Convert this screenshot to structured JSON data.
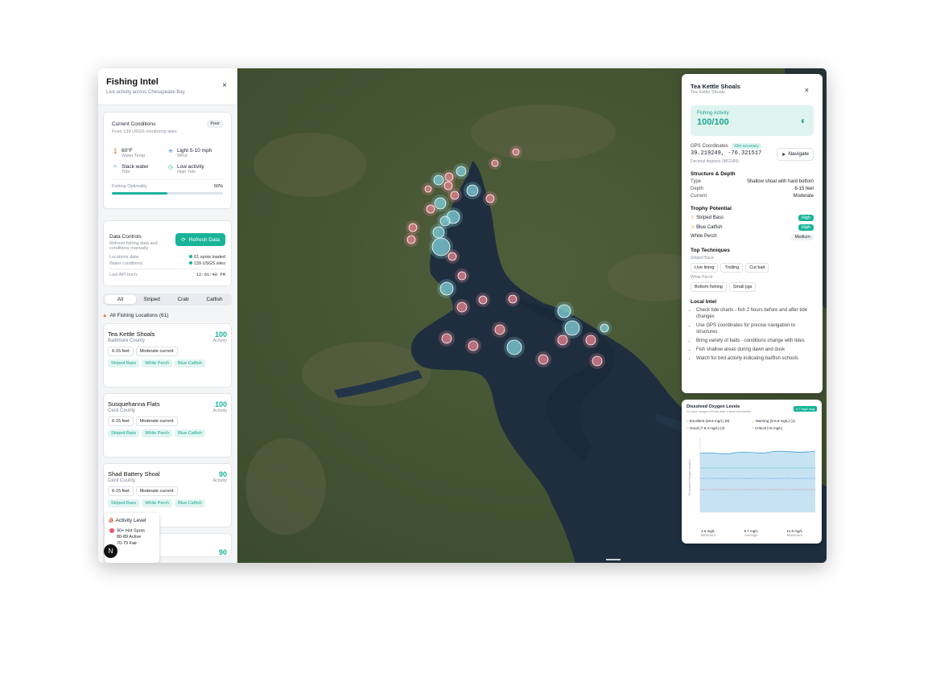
{
  "sidebar": {
    "title": "Fishing Intel",
    "subtitle": "Live activity across Chesapeake Bay",
    "close": "×",
    "conditions": {
      "title": "Current Conditions",
      "badge": "Poor",
      "source": "From 139 USGS monitoring sites",
      "items": [
        {
          "icon": "thermometer-icon",
          "value": "60°F",
          "label": "Water Temp"
        },
        {
          "icon": "wind-icon",
          "value": "Light 5-10 mph",
          "label": "Wind"
        },
        {
          "icon": "water-icon",
          "value": "Slack water",
          "label": "Tide"
        },
        {
          "icon": "clock-icon",
          "value": "Low activity",
          "label": "High Tide"
        }
      ],
      "optimality_label": "Fishing Optimality",
      "optimality_value": "50%",
      "optimality": 0.5
    },
    "data_controls": {
      "title": "Data Controls",
      "desc": "Refresh fishing data and conditions manually",
      "button": "Refresh Data",
      "rows": [
        {
          "label": "Locations data:",
          "value": "61 spots loaded"
        },
        {
          "label": "Water conditions:",
          "value": "139 USGS sites"
        },
        {
          "label": "Last API fetch:",
          "value": "12:01:48 PM"
        }
      ]
    },
    "tabs": [
      "All",
      "Striped",
      "Crab",
      "Catfish"
    ],
    "list_title": "All Fishing Locations (61)",
    "locations": [
      {
        "name": "Tea Kettle Shoals",
        "county": "Baltimore County",
        "score": "100",
        "activity": "Activity",
        "tags": [
          "6-15 feet",
          "Moderate current"
        ],
        "fish": [
          "Striped Bass",
          "White Perch",
          "Blue Catfish"
        ]
      },
      {
        "name": "Susquehanna Flats",
        "county": "Cecil County",
        "score": "100",
        "activity": "Activity",
        "tags": [
          "6-15 feet",
          "Moderate current"
        ],
        "fish": [
          "Striped Bass",
          "White Perch",
          "Blue Catfish"
        ]
      },
      {
        "name": "Shad Battery Shoal",
        "county": "Cecil County",
        "score": "90",
        "activity": "Activity",
        "tags": [
          "6-15 feet",
          "Moderate current"
        ],
        "fish": [
          "Striped Bass",
          "White Perch",
          "Blue Catfish"
        ]
      }
    ],
    "partial_score": "90",
    "legend": {
      "title": "Activity Level",
      "items": [
        {
          "label": "90+ Hot Spots",
          "color": "#e85a6a"
        },
        {
          "label": "80-89 Active",
          "color": "#f08a5d"
        },
        {
          "label": "70-79 Fair",
          "color": "#f2c14e"
        }
      ]
    },
    "next_badge": "N"
  },
  "panel": {
    "title": "Tea Kettle Shoals",
    "subtitle": "Tea Kettle Shoals",
    "close": "×",
    "activity_label": "Fishing Activity",
    "activity_value": "100/100",
    "gps_label": "GPS Coordinates",
    "gps_badge": "±3m accuracy",
    "gps_value": "39.219249, -76.321517",
    "gps_note": "Decimal degrees (WGS84)",
    "navigate": "Navigate",
    "structure_title": "Structure & Depth",
    "structure": [
      {
        "k": "Type",
        "v": "Shallow shoal with hard bottom"
      },
      {
        "k": "Depth",
        "v": "6-15 feet"
      },
      {
        "k": "Current",
        "v": "Moderate"
      }
    ],
    "trophy_title": "Trophy Potential",
    "trophy": [
      {
        "fish": "Striped Bass",
        "level": "High",
        "icon": "trophy-icon"
      },
      {
        "fish": "Blue Catfish",
        "level": "High",
        "icon": "trophy-icon"
      },
      {
        "fish": "White Perch",
        "level": "Medium",
        "icon": ""
      }
    ],
    "tech_title": "Top Techniques",
    "tech_groups": [
      {
        "label": "Striped Bass:",
        "items": [
          "Live lining",
          "Trolling",
          "Cut bait"
        ]
      },
      {
        "label": "White Perch:",
        "items": [
          "Bottom fishing",
          "Small jigs"
        ]
      }
    ],
    "intel_title": "Local Intel",
    "intel": [
      "Check tide charts - fish 2 hours before and after tide changes",
      "Use GPS coordinates for precise navigation to structures",
      "Bring variety of baits - conditions change with tides",
      "Fish shallow areas during dawn and dusk",
      "Watch for bird activity indicating baitfish schools"
    ]
  },
  "oxygen": {
    "title": "Dissolved Oxygen Levels",
    "subtitle": "24-hour oxygen trends with critical thresholds",
    "badge": "9.7 mg/L avg",
    "legend": [
      {
        "label": "Excellent (≥8.5 mg/L) (8)",
        "color": "#19b39a"
      },
      {
        "label": "Warning (5-6.9 mg/L) (1)",
        "color": "#f2a53c"
      },
      {
        "label": "Good (7-8.4 mg/L) (2)",
        "color": "#3b82f6"
      },
      {
        "label": "Critical (<5 mg/L)",
        "color": "#e85a6a"
      }
    ],
    "ylabel": "Dissolved Oxygen (mg/L)",
    "stats": [
      {
        "value": "4.6 mg/L",
        "label": "Minimum"
      },
      {
        "value": "9.7 mg/L",
        "label": "Average"
      },
      {
        "value": "11.6 mg/L",
        "label": "Maximum"
      }
    ]
  }
}
